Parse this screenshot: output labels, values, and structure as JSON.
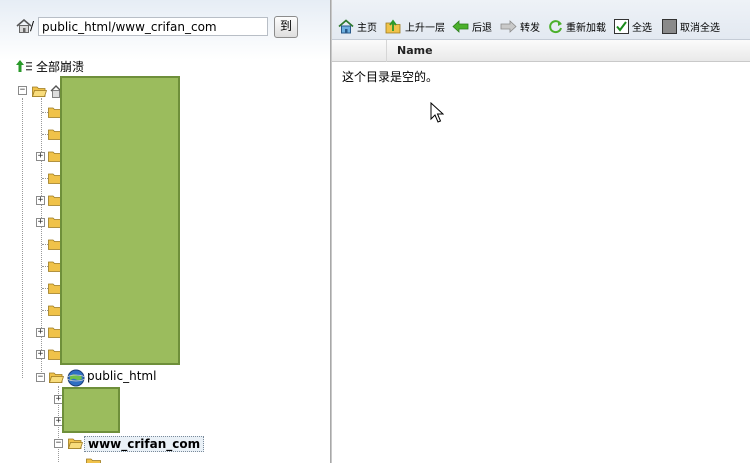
{
  "left": {
    "path_value": "public_html/www_crifan_com",
    "go_label": "到",
    "collapse_all_label": "全部崩溃",
    "tree": {
      "public_html_label": "public_html",
      "current_label": "www_crifan_com"
    }
  },
  "toolbar": {
    "home_label": "主页",
    "up_label": "上升一层",
    "back_label": "后退",
    "forward_label": "转发",
    "reload_label": "重新加载",
    "select_all_label": "全选",
    "deselect_all_label": "取消全选"
  },
  "list": {
    "column_name": "Name",
    "empty_message": "这个目录是空的。"
  },
  "colors": {
    "redaction_fill": "#9bbc5d",
    "redaction_border": "#6e8f3a",
    "folder": "#f0c24a"
  }
}
